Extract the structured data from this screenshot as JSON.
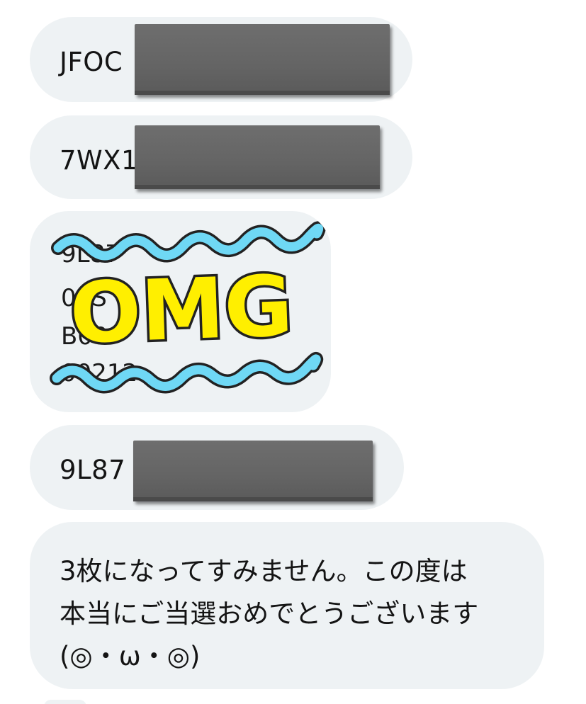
{
  "messages": [
    {
      "code_prefix": "JFOC"
    },
    {
      "code_prefix": "7WX1"
    },
    {
      "sticker": {
        "label": "OMG",
        "underlying_lines": [
          "9L87",
          "01S",
          "B00",
          "00212"
        ],
        "text_color": "#ffef00",
        "outline_color": "#222222",
        "wave_color": "#6fd8f5"
      }
    },
    {
      "code_prefix": "9L87"
    },
    {
      "lines": [
        "3枚になってすみません。この度は",
        "本当にご当選おめでとうございます",
        "(◎・ω・◎)"
      ]
    }
  ],
  "colors": {
    "bubble_bg": "#eef2f4",
    "redaction": "#646464",
    "text": "#141414"
  }
}
